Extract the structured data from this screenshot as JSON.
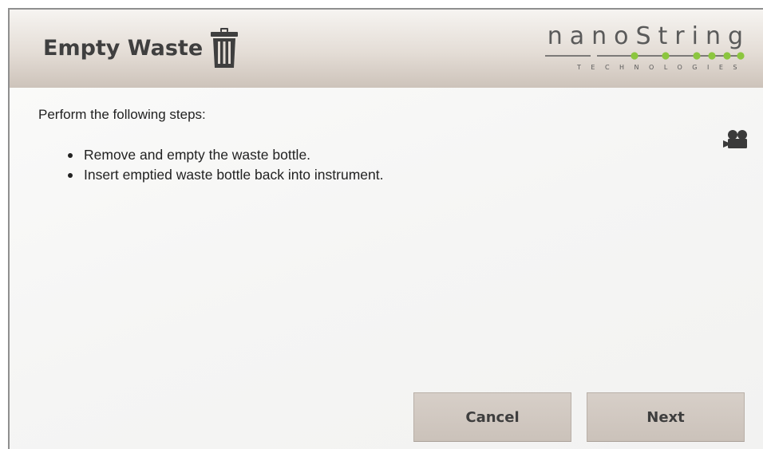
{
  "dialog": {
    "title": "Empty Waste",
    "title_icon": "trash-icon"
  },
  "logo": {
    "wordmark": "nanoString",
    "subtitle": "TECHNOLOGIES",
    "registered": "®",
    "accent_color": "#8cc63f"
  },
  "instructions": {
    "intro": "Perform the following steps:",
    "steps": [
      "Remove and empty the waste bottle.",
      "Insert emptied waste bottle back into instrument."
    ],
    "video_icon": "video-camera-icon"
  },
  "buttons": {
    "cancel_label": "Cancel",
    "next_label": "Next"
  },
  "colors": {
    "header_gradient_start": "#f6f4f1",
    "header_gradient_end": "#cdc3ba",
    "button_bg": "#d2cac3",
    "text": "#222222"
  }
}
